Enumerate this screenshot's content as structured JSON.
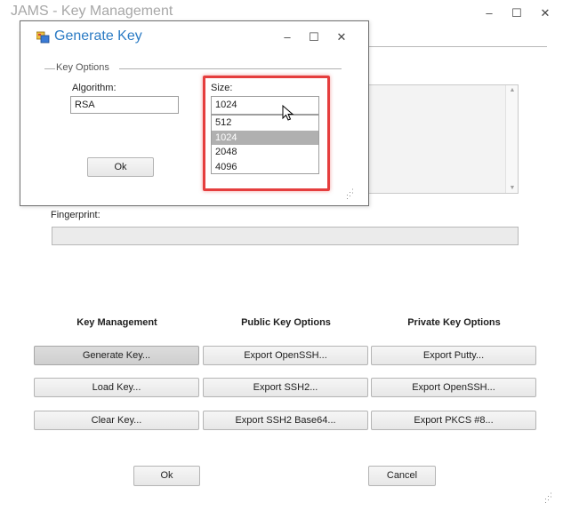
{
  "main_window": {
    "title": "JAMS - Key Management",
    "controls": {
      "minimize": "–",
      "maximize": "☐",
      "close": "✕"
    },
    "fingerprint_label": "Fingerprint:",
    "fingerprint_value": "",
    "key_text": "",
    "columns": [
      {
        "heading": "Key Management",
        "buttons": [
          "Generate Key...",
          "Load Key...",
          "Clear Key..."
        ]
      },
      {
        "heading": "Public Key Options",
        "buttons": [
          "Export OpenSSH...",
          "Export SSH2...",
          "Export SSH2 Base64..."
        ]
      },
      {
        "heading": "Private Key Options",
        "buttons": [
          "Export Putty...",
          "Export OpenSSH...",
          "Export PKCS #8..."
        ]
      }
    ],
    "ok_label": "Ok",
    "cancel_label": "Cancel"
  },
  "dialog": {
    "title": "Generate Key",
    "controls": {
      "minimize": "–",
      "maximize": "☐",
      "close": "✕"
    },
    "group_label": "Key Options",
    "algorithm_label": "Algorithm:",
    "algorithm_value": "RSA",
    "size_label": "Size:",
    "size_value": "1024",
    "size_options": [
      "512",
      "1024",
      "2048",
      "4096"
    ],
    "size_selected_index": 1,
    "ok_label": "Ok"
  },
  "colors": {
    "dialog_title": "#2b7bc4",
    "highlight_box": "#e53e3e",
    "selected_option": "#b0b0b0",
    "main_title": "#a7a7a7"
  },
  "icons": [
    "window-app-icon",
    "mouse-cursor-icon",
    "resize-grip-icon"
  ]
}
